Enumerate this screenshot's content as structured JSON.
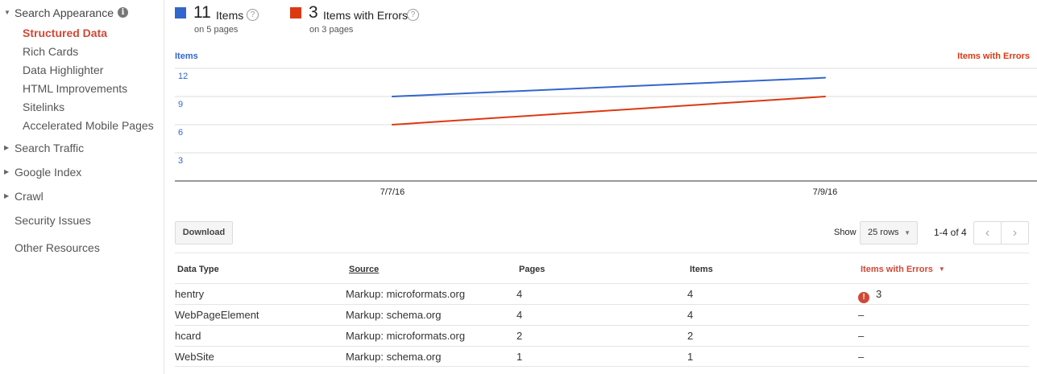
{
  "sidebar": {
    "sections": [
      {
        "label": "Search Appearance",
        "expanded": true,
        "items": [
          "Structured Data",
          "Rich Cards",
          "Data Highlighter",
          "HTML Improvements",
          "Sitelinks",
          "Accelerated Mobile Pages"
        ],
        "active_item": "Structured Data"
      },
      {
        "label": "Search Traffic",
        "expanded": false
      },
      {
        "label": "Google Index",
        "expanded": false
      },
      {
        "label": "Crawl",
        "expanded": false
      },
      {
        "label": "Security Issues",
        "expanded": false
      },
      {
        "label": "Other Resources",
        "expanded": false
      }
    ],
    "info_icon_glyph": "i"
  },
  "summary": {
    "items": {
      "count": "11",
      "label": "Items",
      "sub": "on 5 pages",
      "color": "#3366cc"
    },
    "errors": {
      "count": "3",
      "label": "Items with Errors",
      "sub": "on 3 pages",
      "color": "#dc3912"
    },
    "help_glyph": "?"
  },
  "chart_data": {
    "type": "line",
    "x": [
      "7/7/16",
      "7/9/16"
    ],
    "left_axis_title": "Items",
    "right_axis_title": "Items with Errors",
    "left_ticks": [
      3,
      6,
      9,
      12
    ],
    "left_ylim": [
      0,
      12
    ],
    "right_ylim": [
      0,
      4
    ],
    "grid": true,
    "series": [
      {
        "name": "Items",
        "axis": "left",
        "color": "#3366cc",
        "values": [
          9,
          11
        ]
      },
      {
        "name": "Items with Errors",
        "axis": "right",
        "color": "#dc3912",
        "values": [
          2,
          3
        ]
      }
    ]
  },
  "controls": {
    "download_label": "Download",
    "show_label": "Show",
    "rows_select": "25 rows",
    "pagination": "1-4 of 4"
  },
  "table": {
    "headers": [
      "Data Type",
      "Source",
      "Pages",
      "Items",
      "Items with Errors"
    ],
    "sorted_column": "Items with Errors",
    "rows": [
      {
        "type": "hentry",
        "source": "Markup: microformats.org",
        "pages": "4",
        "items": "4",
        "errors": "3",
        "has_error": true
      },
      {
        "type": "WebPageElement",
        "source": "Markup: schema.org",
        "pages": "4",
        "items": "4",
        "errors": "–",
        "has_error": false
      },
      {
        "type": "hcard",
        "source": "Markup: microformats.org",
        "pages": "2",
        "items": "2",
        "errors": "–",
        "has_error": false
      },
      {
        "type": "WebSite",
        "source": "Markup: schema.org",
        "pages": "1",
        "items": "1",
        "errors": "–",
        "has_error": false
      }
    ]
  }
}
